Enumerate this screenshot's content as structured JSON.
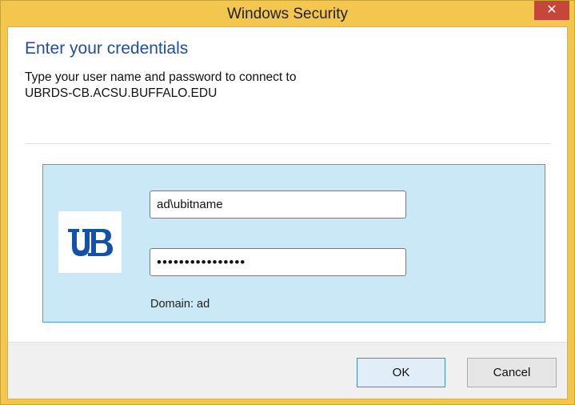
{
  "window": {
    "title": "Windows Security",
    "close_glyph": "✕"
  },
  "dialog": {
    "heading": "Enter your credentials",
    "instruction": "Type your user name and password to connect to",
    "host": "UBRDS-CB.ACSU.BUFFALO.EDU"
  },
  "credentials": {
    "username_value": "ad\\ubitname",
    "password_value": "pppppppppppppppp",
    "domain_label": "Domain: ad",
    "logo_icon": "ub-logo-icon"
  },
  "buttons": {
    "ok_label": "OK",
    "cancel_label": "Cancel"
  },
  "colors": {
    "title_bar": "#f3c64e",
    "close_button": "#c7463a",
    "heading_text": "#1e4e9c",
    "tile_background": "#cbe8f6",
    "tile_border": "#4aa3d6",
    "logo_blue": "#1252a8"
  }
}
